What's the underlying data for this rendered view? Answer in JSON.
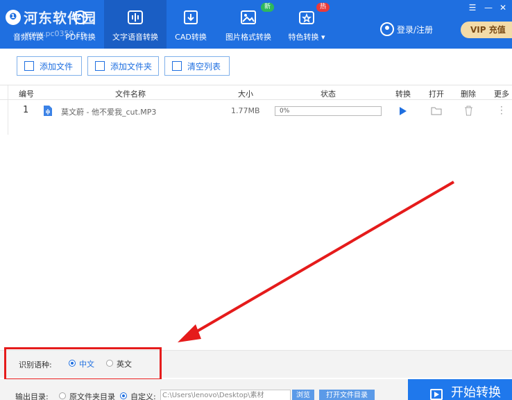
{
  "app": {
    "logo_text": "河东软件园",
    "logo_url": "www.pc0359.cn"
  },
  "nav": {
    "items": [
      {
        "label": "音频转换",
        "icon": "audio-icon"
      },
      {
        "label": "PDF转换",
        "icon": "pdf-icon"
      },
      {
        "label": "文字语音转换",
        "icon": "waveform-icon"
      },
      {
        "label": "CAD转换",
        "icon": "cad-icon"
      },
      {
        "label": "图片格式转换",
        "icon": "image-icon"
      },
      {
        "label": "特色转换 ▾",
        "icon": "star-convert-icon"
      }
    ],
    "badge_new": "新",
    "badge_hot": "热"
  },
  "header": {
    "login_label": "登录/注册",
    "vip_label": "VIP 充值"
  },
  "toolbar": {
    "add_file": "添加文件",
    "add_folder": "添加文件夹",
    "clear_list": "清空列表"
  },
  "table": {
    "headers": [
      "编号",
      "文件名称",
      "大小",
      "状态",
      "转换",
      "打开",
      "删除",
      "更多"
    ],
    "rows": [
      {
        "index": "1",
        "name": "莫文蔚 - 他不爱我_cut.MP3",
        "size": "1.77MB",
        "status": "0%"
      }
    ]
  },
  "language": {
    "label": "识别语种:",
    "options": [
      "中文",
      "英文"
    ],
    "selected": "中文"
  },
  "output": {
    "label": "输出目录:",
    "option_source": "原文件夹目录",
    "option_custom": "自定义:",
    "path": "C:\\Users\\lenovo\\Desktop\\素材",
    "browse": "浏览",
    "open_folder": "打开文件目录"
  },
  "start_button": "开始转换",
  "colors": {
    "primary": "#1f6fe0",
    "highlight_box": "#e51b1b",
    "badge_new": "#2eb85c",
    "badge_hot": "#ea3a3a"
  }
}
